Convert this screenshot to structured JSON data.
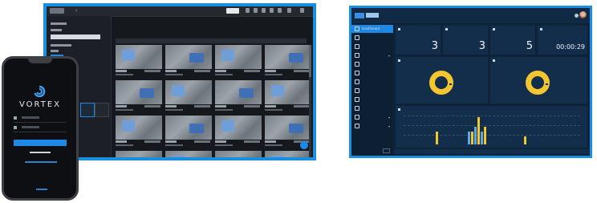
{
  "phone": {
    "brand": "VORTEX"
  },
  "monitor_window": {
    "title": ""
  },
  "dashboard": {
    "app_title": "",
    "user": "",
    "nav": [
      {
        "label": "Dashboard",
        "active": true
      },
      {
        "label": "",
        "active": false
      },
      {
        "label": "",
        "active": false
      },
      {
        "label": "",
        "active": false
      },
      {
        "label": "",
        "active": false
      },
      {
        "label": "",
        "active": false
      },
      {
        "label": "",
        "active": false
      },
      {
        "label": "",
        "active": false
      },
      {
        "label": "",
        "active": false
      },
      {
        "label": "",
        "active": false
      },
      {
        "label": "",
        "active": false
      },
      {
        "label": "",
        "active": false
      }
    ],
    "kpis": [
      {
        "value": "3"
      },
      {
        "value": "3"
      },
      {
        "value": "5"
      },
      {
        "value": "00:00:29"
      }
    ],
    "colors": {
      "accent": "#1e88e5",
      "donut": "#f2c531",
      "series_a": "#f2c531",
      "series_b": "#5aa9e6",
      "background": "#0f2338"
    }
  }
}
